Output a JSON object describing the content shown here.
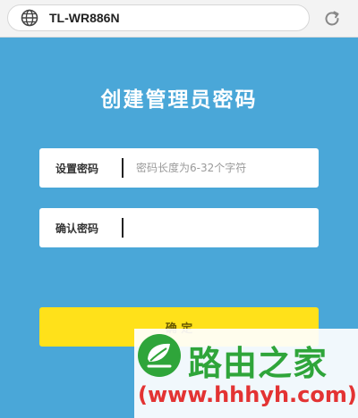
{
  "browser": {
    "url": "TL-WR886N",
    "icons": {
      "site": "globe-icon",
      "reload": "reload-icon"
    }
  },
  "page": {
    "title": "创建管理员密码",
    "fields": [
      {
        "label": "设置密码",
        "value": "",
        "placeholder": "密码长度为6-32个字符"
      },
      {
        "label": "确认密码",
        "value": "",
        "placeholder": ""
      }
    ],
    "confirm_label": "确 定"
  },
  "watermark": {
    "name": "路由之家",
    "url": "(www.hhhyh.com)"
  },
  "colors": {
    "background": "#4aa7d8",
    "button": "#ffe11a",
    "watermark_green": "#2fa53a",
    "watermark_red": "#e33333"
  }
}
